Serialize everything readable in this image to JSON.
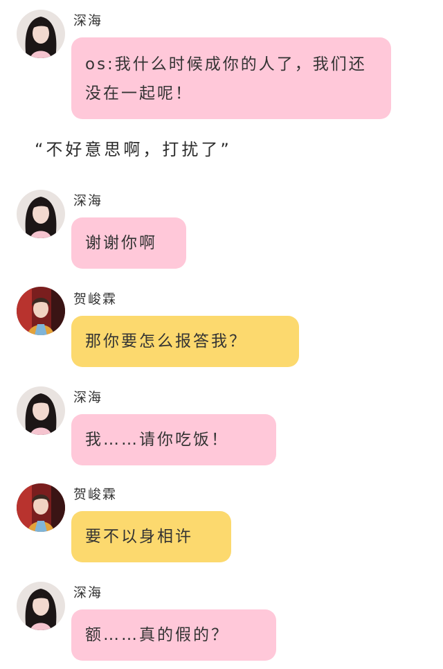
{
  "messages": [
    {
      "id": "m1",
      "sender": "深海",
      "text": "os:我什么时候成你的人了，我们还没在一起呢！",
      "color": "#ffc8d9",
      "avatar": "girl-avatar"
    },
    {
      "id": "m2",
      "sender": "深海",
      "text": "谢谢你啊",
      "color": "#ffc8d9",
      "avatar": "girl-avatar"
    },
    {
      "id": "m3",
      "sender": "贺峻霖",
      "text": "那你要怎么报答我？",
      "color": "#fcd96e",
      "avatar": "boy-avatar"
    },
    {
      "id": "m4",
      "sender": "深海",
      "text": "我……请你吃饭！",
      "color": "#ffc8d9",
      "avatar": "girl-avatar"
    },
    {
      "id": "m5",
      "sender": "贺峻霖",
      "text": "要不以身相许",
      "color": "#fcd96e",
      "avatar": "boy-avatar"
    },
    {
      "id": "m6",
      "sender": "深海",
      "text": "额……真的假的？",
      "color": "#ffc8d9",
      "avatar": "girl-avatar"
    }
  ],
  "narration": "“不好意思啊，打扰了”",
  "colors": {
    "pink_bubble": "#ffc8d9",
    "yellow_bubble": "#fcd96e"
  }
}
